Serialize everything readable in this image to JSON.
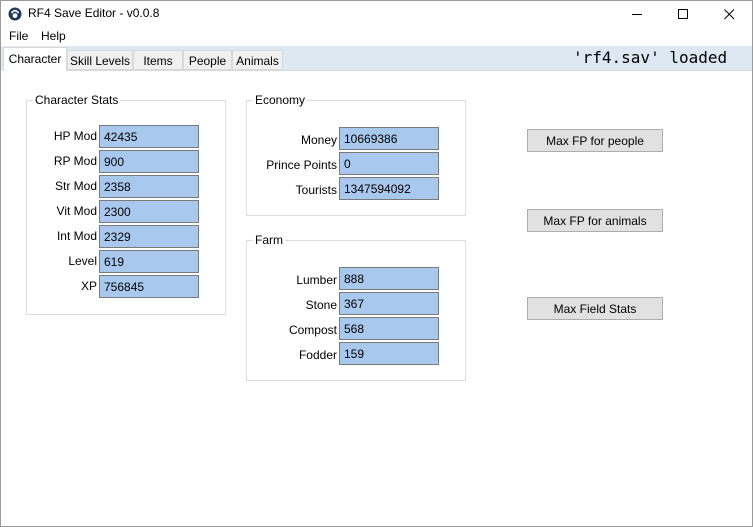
{
  "window": {
    "title": "RF4 Save Editor - v0.0.8",
    "controls": {
      "minimize": "—",
      "maximize": "☐",
      "close": "✕"
    }
  },
  "menu": [
    "File",
    "Help"
  ],
  "tabs": [
    "Character",
    "Skill Levels",
    "Items",
    "People",
    "Animals"
  ],
  "active_tab": "Character",
  "status": "'rf4.sav' loaded",
  "character_stats": {
    "title": "Character Stats",
    "fields": [
      {
        "label": "HP Mod",
        "value": "42435"
      },
      {
        "label": "RP Mod",
        "value": "900"
      },
      {
        "label": "Str Mod",
        "value": "2358"
      },
      {
        "label": "Vit Mod",
        "value": "2300"
      },
      {
        "label": "Int Mod",
        "value": "2329"
      },
      {
        "label": "Level",
        "value": "619"
      },
      {
        "label": "XP",
        "value": "756845"
      }
    ]
  },
  "economy": {
    "title": "Economy",
    "fields": [
      {
        "label": "Money",
        "value": "10669386"
      },
      {
        "label": "Prince Points",
        "value": "0"
      },
      {
        "label": "Tourists",
        "value": "1347594092"
      }
    ]
  },
  "farm": {
    "title": "Farm",
    "fields": [
      {
        "label": "Lumber",
        "value": "888"
      },
      {
        "label": "Stone",
        "value": "367"
      },
      {
        "label": "Compost",
        "value": "568"
      },
      {
        "label": "Fodder",
        "value": "159"
      }
    ]
  },
  "actions": {
    "max_fp_people": "Max FP for people",
    "max_fp_animals": "Max FP for animals",
    "max_field_stats": "Max Field Stats"
  }
}
